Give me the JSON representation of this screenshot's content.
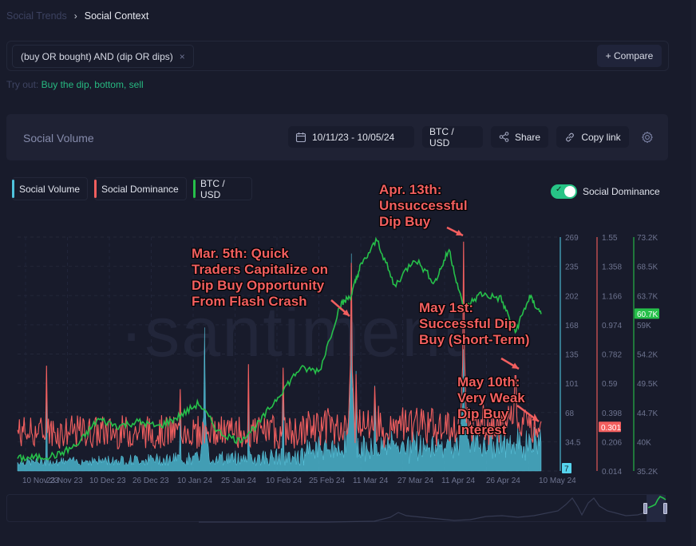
{
  "breadcrumb": {
    "parent": "Social Trends",
    "separator": "›",
    "current": "Social Context"
  },
  "search": {
    "query": "(buy OR bought) AND (dip OR dips)",
    "remove_icon": "close-icon",
    "compare_label": "+ Compare"
  },
  "tryout": {
    "label": "Try out:",
    "suggestions": "Buy the dip, bottom, sell"
  },
  "widget": {
    "title": "Social Volume",
    "date_range": "10/11/23 - 10/05/24",
    "pair": "BTC / USD",
    "share_label": "Share",
    "copy_link_label": "Copy link",
    "settings_icon": "gear-icon"
  },
  "legend": [
    {
      "label": "Social Volume",
      "color": "#4fc3dd"
    },
    {
      "label": "Social Dominance",
      "color": "#f05e5e"
    },
    {
      "label": "BTC / USD",
      "color": "#26c04a"
    }
  ],
  "toggle": {
    "label": "Social Dominance",
    "on": true
  },
  "watermark": "·santiment",
  "annotations": [
    {
      "text": "Mar. 5th: Quick\nTraders Capitalize on\nDip Buy Opportunity\nFrom Flash Crash"
    },
    {
      "text": "Apr. 13th:\nUnsuccessful\nDip Buy"
    },
    {
      "text": "May 1st:\nSuccessful Dip\nBuy (Short-Term)"
    },
    {
      "text": "May 10th:\nVery Weak\nDip Buy\nInterest"
    }
  ],
  "chart_data": {
    "type": "line",
    "title": "Social Volume",
    "x_tick_labels": [
      "10 Nov 23",
      "23 Nov 23",
      "10 Dec 23",
      "26 Dec 23",
      "10 Jan 24",
      "25 Jan 24",
      "10 Feb 24",
      "25 Feb 24",
      "11 Mar 24",
      "27 Mar 24",
      "11 Apr 24",
      "26 Apr 24",
      "10 May 24"
    ],
    "axes": [
      {
        "name": "Social Volume",
        "color": "#4fc3dd",
        "ticks": [
          "269",
          "235",
          "202",
          "168",
          "135",
          "101",
          "68",
          "34.5",
          ""
        ],
        "ylim": [
          0,
          269
        ],
        "current_value": "7"
      },
      {
        "name": "Social Dominance",
        "color": "#f05e5e",
        "ticks": [
          "1.55",
          "1.358",
          "1.166",
          "0.974",
          "0.782",
          "0.59",
          "0.398",
          "0.206",
          "0.014"
        ],
        "ylim": [
          0.014,
          1.55
        ],
        "current_value": "0.301"
      },
      {
        "name": "BTC / USD",
        "color": "#26c04a",
        "ticks": [
          "73.2K",
          "68.5K",
          "63.7K",
          "59K",
          "54.2K",
          "49.5K",
          "44.7K",
          "40K",
          "35.2K"
        ],
        "ylim": [
          35200,
          73200
        ],
        "current_value": "60.7K"
      }
    ],
    "series": [
      {
        "name": "BTC / USD",
        "x": [
          "10 Nov 23",
          "17 Nov 23",
          "24 Nov 23",
          "1 Dec 23",
          "8 Dec 23",
          "15 Dec 23",
          "22 Dec 23",
          "29 Dec 23",
          "5 Jan 24",
          "12 Jan 24",
          "19 Jan 24",
          "26 Jan 24",
          "2 Feb 24",
          "9 Feb 24",
          "16 Feb 24",
          "23 Feb 24",
          "1 Mar 24",
          "5 Mar 24",
          "8 Mar 24",
          "14 Mar 24",
          "20 Mar 24",
          "27 Mar 24",
          "3 Apr 24",
          "8 Apr 24",
          "13 Apr 24",
          "19 Apr 24",
          "26 Apr 24",
          "1 May 24",
          "6 May 24",
          "10 May 24"
        ],
        "values": [
          37200,
          37400,
          37800,
          39500,
          43600,
          42500,
          43200,
          42400,
          44000,
          46200,
          41500,
          40100,
          43000,
          47600,
          51800,
          51500,
          62000,
          63800,
          68200,
          72800,
          65200,
          69800,
          65800,
          71200,
          61500,
          64000,
          63200,
          57800,
          63500,
          60700
        ]
      },
      {
        "name": "Social Dominance",
        "peaks": [
          {
            "date": "5 Mar 24",
            "value": 1.38
          },
          {
            "date": "13 Apr 24",
            "value": 1.52
          },
          {
            "date": "1 May 24",
            "value": 0.64
          },
          {
            "date": "10 May 24",
            "value": 0.34
          }
        ],
        "baseline_range": [
          0.15,
          0.45
        ]
      },
      {
        "name": "Social Volume",
        "peaks": [
          {
            "date": "14 Jan 24",
            "value": 165
          },
          {
            "date": "5 Mar 24",
            "value": 250
          },
          {
            "date": "13 Apr 24",
            "value": 140
          }
        ],
        "baseline_range": [
          5,
          40
        ]
      }
    ],
    "grid": true,
    "legend": "top-left"
  }
}
